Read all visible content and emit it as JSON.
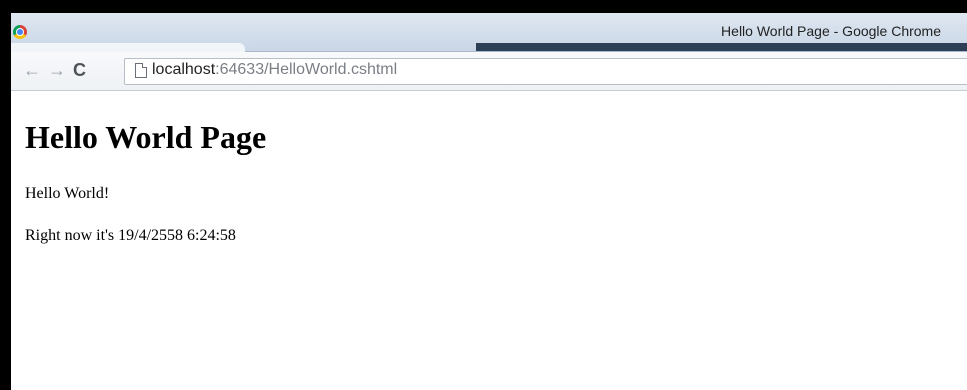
{
  "window": {
    "title": "Hello World Page - Google Chrome"
  },
  "toolbar": {
    "back_icon": "back-arrow-icon",
    "forward_icon": "forward-arrow-icon",
    "reload_icon": "reload-icon",
    "address": {
      "host": "localhost",
      "rest": ":64633/HelloWorld.cshtml"
    }
  },
  "page": {
    "heading": "Hello World Page",
    "greeting": "Hello World!",
    "time_text": "Right now it's 19/4/2558 6:24:58"
  }
}
